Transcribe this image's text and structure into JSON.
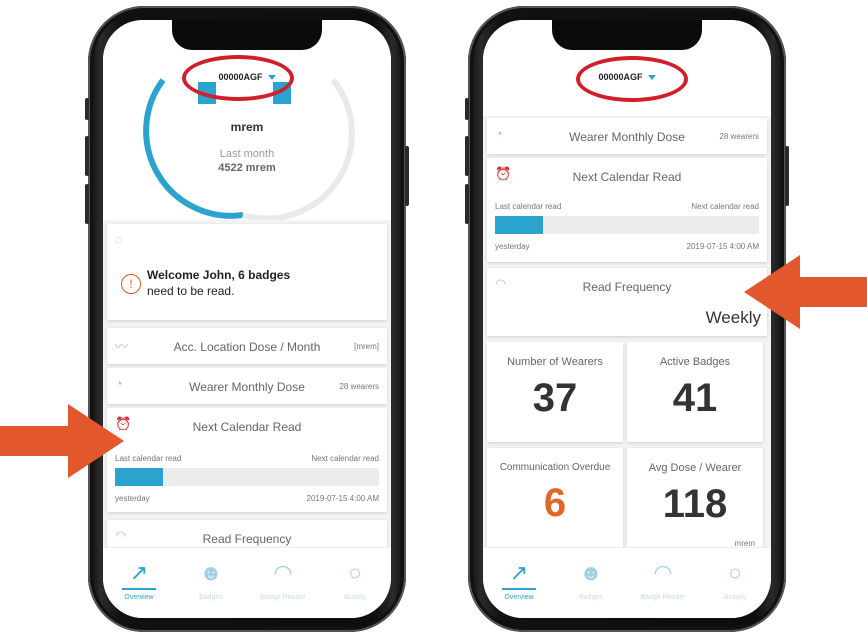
{
  "left_phone": {
    "badge_id": "00000AGF",
    "gauge": {
      "unit": "mrem",
      "sub_label": "Last month",
      "sub_value": "4522 mrem"
    },
    "welcome_line1": "Welcome John, 6 badges",
    "welcome_line2": "need to be read.",
    "acc_location": {
      "title": "Acc. Location Dose / Month",
      "unit": "[mrem]"
    },
    "wearer_monthly": {
      "title": "Wearer Monthly Dose",
      "count": "28 wearers"
    },
    "calendar": {
      "title": "Next Calendar Read",
      "last_label": "Last calendar read",
      "next_label": "Next calendar read",
      "last_value": "yesterday",
      "next_value": "2019-07-15 4:00 AM",
      "progress": 0.18
    },
    "read_frequency": {
      "title": "Read Frequency"
    }
  },
  "right_phone": {
    "badge_id": "00000AGF",
    "wearer_monthly": {
      "title": "Wearer Monthly Dose",
      "count": "28 wearers"
    },
    "calendar": {
      "title": "Next Calendar Read",
      "last_label": "Last calendar read",
      "next_label": "Next calendar read",
      "last_value": "yesterday",
      "next_value": "2019-07-15 4:00 AM",
      "progress": 0.18
    },
    "read_frequency": {
      "title": "Read Frequency",
      "value": "Weekly"
    },
    "stats": {
      "wearers": {
        "label": "Number of Wearers",
        "value": "37"
      },
      "active": {
        "label": "Active Badges",
        "value": "41"
      },
      "overdue": {
        "label": "Communication Overdue",
        "value": "6"
      },
      "avg": {
        "label": "Avg Dose / Wearer",
        "value": "118",
        "unit": "mrem"
      }
    }
  },
  "nav": {
    "overview": "Overview",
    "badges": "Badges",
    "reader": "Badge Reader",
    "activity": "Activity"
  },
  "colors": {
    "accent": "#2aa3cf",
    "highlight_oval": "#d01f2a",
    "arrow": "#e2572b",
    "overdue": "#e0662a"
  }
}
